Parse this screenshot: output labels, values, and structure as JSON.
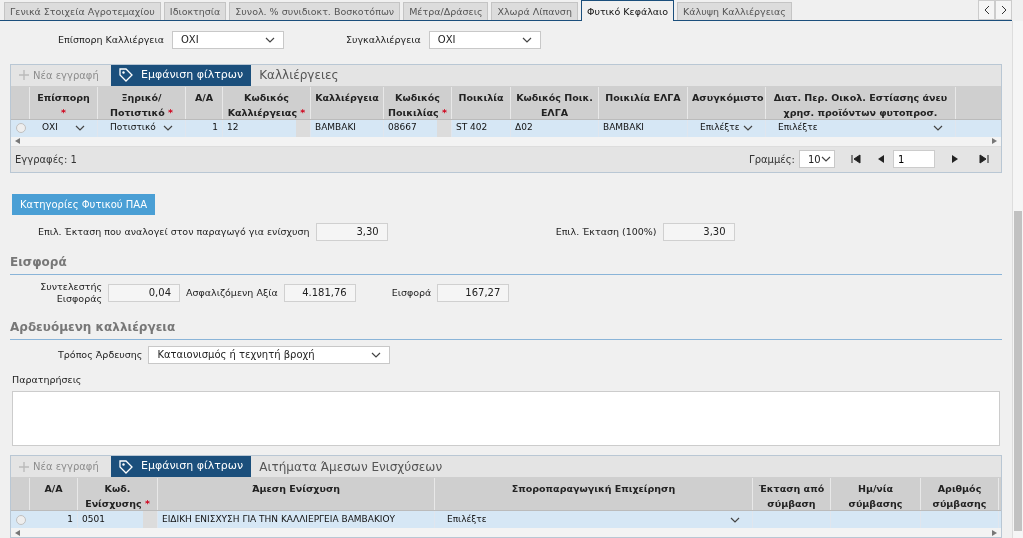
{
  "tabs": [
    {
      "label": "Γενικά Στοιχεία Αγροτεμαχίου",
      "selected": false
    },
    {
      "label": "Ιδιοκτησία",
      "selected": false
    },
    {
      "label": "Συνολ. % συνιδιοκτ. Βοσκοτόπων",
      "selected": false
    },
    {
      "label": "Μέτρα/Δράσεις",
      "selected": false
    },
    {
      "label": "Χλωρά Λίπανση",
      "selected": false
    },
    {
      "label": "Φυτικό Κεφάλαιο",
      "selected": true
    },
    {
      "label": "Κάλυψη Καλλιέργειας",
      "selected": false
    }
  ],
  "top_fields": [
    {
      "label": "Επίσπορη Καλλιέργεια",
      "value": "ΟΧΙ"
    },
    {
      "label": "Συγκαλλιέργεια",
      "value": "ΟΧΙ"
    }
  ],
  "crops_grid": {
    "new_button": "Νέα εγγραφή",
    "filter_button": "Εμφάνιση φίλτρων",
    "title": "Καλλιέργειες",
    "columns": [
      {
        "label": "Επίσπορη",
        "mark": "*"
      },
      {
        "label": "Ξηρικό/ Ποτιστικό",
        "mark": "*"
      },
      {
        "label": "Α/Α"
      },
      {
        "label": "Κωδικός Καλλιέργειας",
        "mark": "*"
      },
      {
        "label": "Καλλιέργεια"
      },
      {
        "label": "Κωδικός Ποικιλίας",
        "mark": "*"
      },
      {
        "label": "Ποικιλία"
      },
      {
        "label": "Κωδικός Ποικ. ΕΛΓΑ"
      },
      {
        "label": "Ποικιλία ΕΛΓΑ"
      },
      {
        "label": "Ασυγκόμιστο"
      },
      {
        "label": "Διατ. Περ. Οικολ. Εστίασης άνευ χρησ. προϊόντων φυτοπροσ."
      }
    ],
    "rows": [
      {
        "selected": false,
        "cells": [
          {
            "kind": "select",
            "value": "ΟΧΙ"
          },
          {
            "kind": "select",
            "value": "Ποτιστικό"
          },
          {
            "kind": "number",
            "value": "1"
          },
          {
            "kind": "input",
            "value": "12"
          },
          {
            "kind": "text",
            "value": "ΒΑΜΒΑΚΙ"
          },
          {
            "kind": "input",
            "value": "08667"
          },
          {
            "kind": "text",
            "value": "ST 402"
          },
          {
            "kind": "text",
            "value": "Δ02"
          },
          {
            "kind": "text",
            "value": "ΒΑΜΒΑΚΙ"
          },
          {
            "kind": "select",
            "value": "Επιλέξτε"
          },
          {
            "kind": "select",
            "value": "Επιλέξτε"
          }
        ]
      }
    ],
    "records": "Εγγραφές: 1",
    "rows_label": "Γραμμές:",
    "page_size": "10",
    "page": "1"
  },
  "category_button": "Κατηγορίες Φυτικού ΠΑΑ",
  "area_fields": [
    {
      "label": "Επιλ. Έκταση που αναλογεί στον παραγωγό για ενίσχυση",
      "value": "3,30"
    },
    {
      "label": "Επιλ. Έκταση (100%)",
      "value": "3,30"
    }
  ],
  "contribution": {
    "heading": "Εισφορά",
    "fields": [
      {
        "label": "Συντελεστής Εισφοράς",
        "value": "0,04"
      },
      {
        "label": "Ασφαλιζόμενη Αξία",
        "value": "4.181,76"
      },
      {
        "label": "Εισφορά",
        "value": "167,27"
      }
    ]
  },
  "irrigation": {
    "heading": "Αρδευόμενη καλλιέργεια",
    "method_label": "Τρόπος Άρδευσης",
    "method_value": "Καταιονισμός ή τεχνητή βροχή"
  },
  "remarks": {
    "label": "Παρατηρήσεις"
  },
  "aid_grid": {
    "new_button": "Νέα εγγραφή",
    "filter_button": "Εμφάνιση φίλτρων",
    "title": "Αιτήματα Άμεσων Ενισχύσεων",
    "columns": [
      {
        "label": "Α/Α"
      },
      {
        "label": "Κωδ. Ενίσχυσης",
        "mark": "*"
      },
      {
        "label": "Άμεση Ενίσχυση"
      },
      {
        "label": "Σποροπαραγωγική Επιχείρηση"
      },
      {
        "label": "Έκταση από σύμβαση"
      },
      {
        "label": "Ημ/νία σύμβασης"
      },
      {
        "label": "Αριθμός σύμβασης"
      }
    ],
    "rows": [
      {
        "selected": false,
        "cells": [
          {
            "kind": "number",
            "value": "1"
          },
          {
            "kind": "input",
            "value": "0501"
          },
          {
            "kind": "text",
            "value": "ΕΙΔΙΚΗ ΕΝΙΣΧΥΣΗ ΓΙΑ ΤΗΝ ΚΑΛΛΙΕΡΓΕΙΑ ΒΑΜΒΑΚΙΟΥ"
          },
          {
            "kind": "select",
            "value": "Επιλέξτε"
          },
          {
            "kind": "empty"
          },
          {
            "kind": "empty"
          },
          {
            "kind": "empty"
          }
        ]
      }
    ]
  }
}
